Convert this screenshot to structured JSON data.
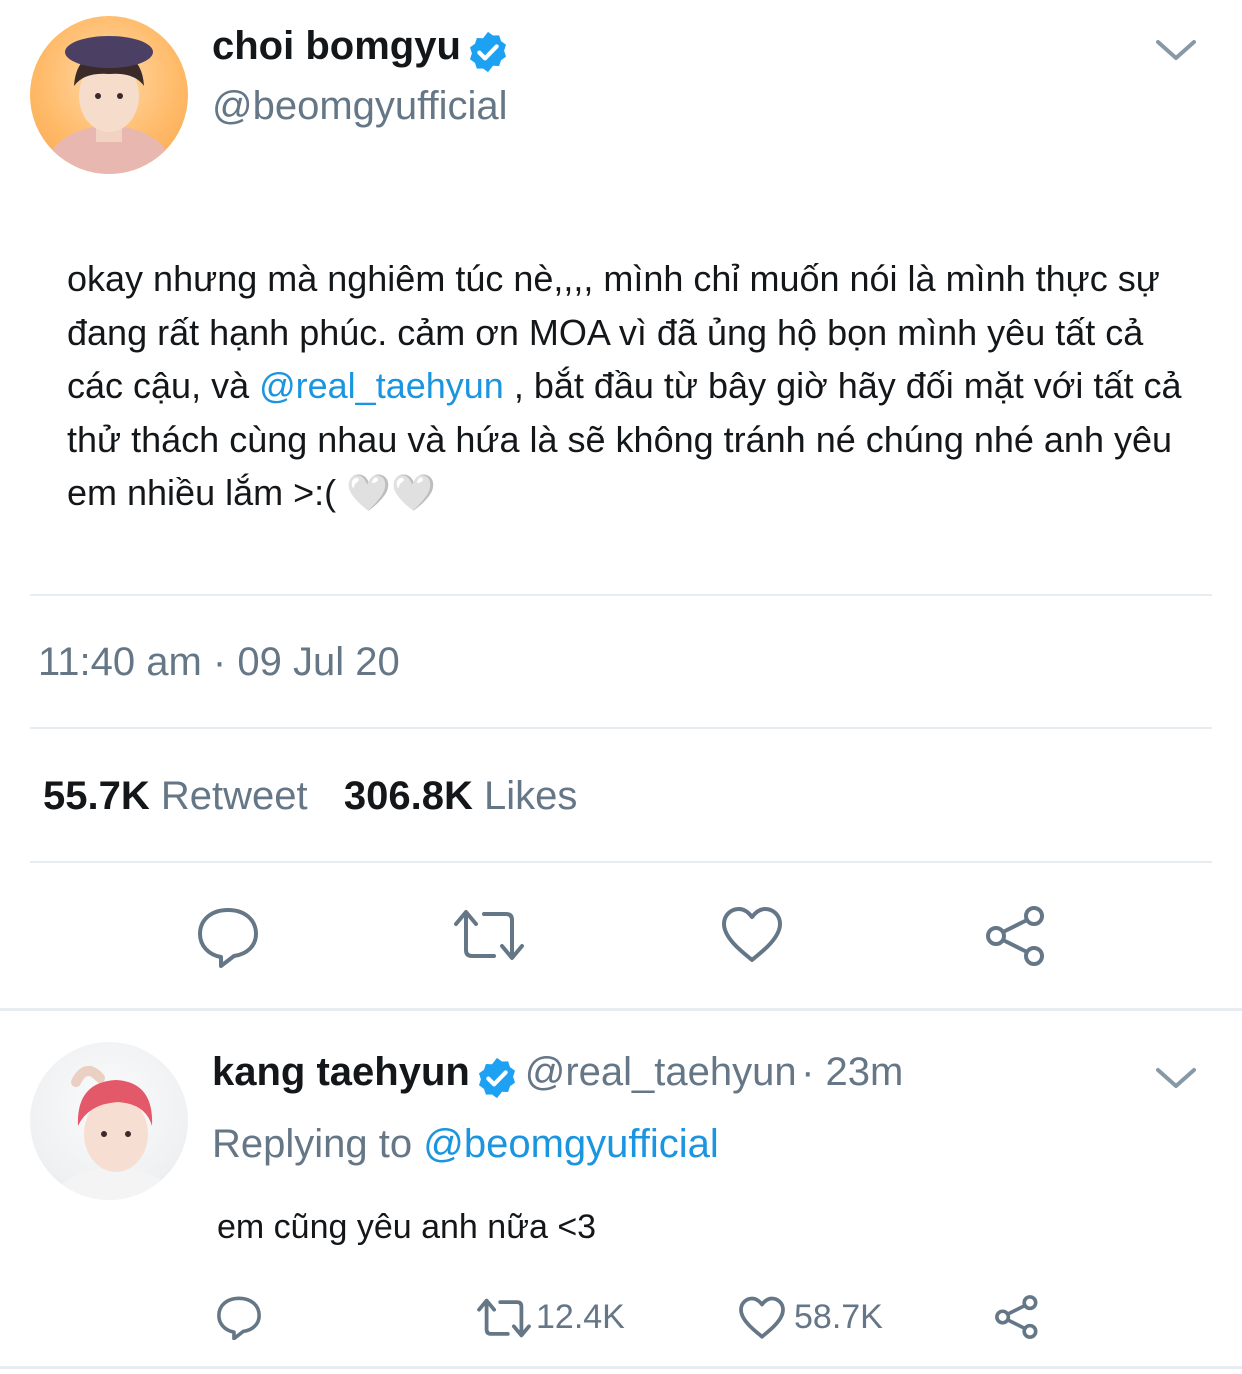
{
  "main_tweet": {
    "author_name": "choi bomgyu",
    "author_handle": "@beomgyufficial",
    "text_before_mention": "okay nhưng mà nghiêm túc nè,,,, mình chỉ muốn nói là mình thực sự đang rất hạnh phúc. cảm ơn MOA vì đã ủng hộ bọn mình yêu tất cả các cậu, và ",
    "mention": "@real_taehyun",
    "text_after_mention": " , bắt đầu từ bây giờ hãy đối mặt với tất cả thử thách cùng nhau và hứa là sẽ không tránh né chúng nhé anh yêu em nhiều lắm >:( ",
    "emoji": "🤍🤍",
    "timestamp": "11:40 am · 09 Jul 20",
    "retweet_count": "55.7K",
    "retweet_label": "Retweet",
    "like_count": "306.8K",
    "like_label": "Likes"
  },
  "reply_tweet": {
    "author_name": "kang taehyun",
    "author_handle": "@real_taehyun",
    "time_ago": "· 23m",
    "replying_label": "Replying to",
    "replying_handle": "@beomgyufficial",
    "text": "em cũng yêu anh nữa <3",
    "retweet_count": "12.4K",
    "like_count": "58.7K"
  },
  "icons": {
    "verified": "verified-badge-icon",
    "chevron": "chevron-down-icon",
    "reply": "reply-icon",
    "retweet": "retweet-icon",
    "like": "heart-icon",
    "share": "share-icon"
  },
  "colors": {
    "accent": "#1da1f2",
    "mention": "#1b95e0",
    "secondary_text": "#657786",
    "icon": "#657786",
    "divider": "#e6ecf0"
  }
}
